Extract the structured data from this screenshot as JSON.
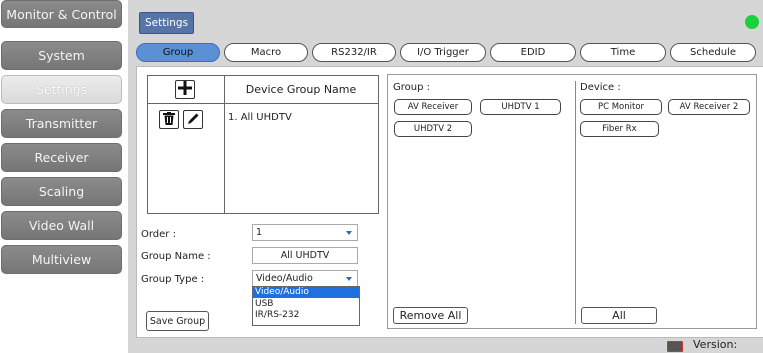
{
  "sidebar": {
    "items": [
      {
        "label": "Monitor & Control"
      },
      {
        "label": "System"
      },
      {
        "label": "Settings"
      },
      {
        "label": "Transmitter"
      },
      {
        "label": "Receiver"
      },
      {
        "label": "Scaling"
      },
      {
        "label": "Video Wall"
      },
      {
        "label": "Multiview"
      }
    ],
    "active": "Settings"
  },
  "header": {
    "title": "Settings",
    "status_color": "#19d13a"
  },
  "tabs": [
    {
      "label": "Group"
    },
    {
      "label": "Macro"
    },
    {
      "label": "RS232/IR"
    },
    {
      "label": "I/O Trigger"
    },
    {
      "label": "EDID"
    },
    {
      "label": "Time"
    },
    {
      "label": "Schedule"
    }
  ],
  "active_tab": "Group",
  "group_table": {
    "column_header": "Device Group Name",
    "rows": [
      "1. All UHDTV"
    ],
    "add_icon": "plus-icon",
    "delete_icon": "trash-icon",
    "edit_icon": "pencil-icon"
  },
  "form": {
    "order_label": "Order :",
    "order_value": "1",
    "group_name_label": "Group Name :",
    "group_name_value": "All UHDTV",
    "group_type_label": "Group Type :",
    "group_type_value": "Video/Audio",
    "group_type_options": [
      "Video/Audio",
      "USB",
      "IR/RS-232"
    ],
    "save_button": "Save Group"
  },
  "group_panel": {
    "label": "Group :",
    "chips": [
      "AV Receiver",
      "UHDTV 1",
      "UHDTV 2"
    ],
    "remove_all_button": "Remove All"
  },
  "device_panel": {
    "label": "Device :",
    "chips": [
      "PC Monitor",
      "AV Receiver 2",
      "Fiber Rx"
    ],
    "all_button": "All"
  },
  "footer": {
    "version_label": "Version:",
    "keyboard_icon": "keyboard-icon"
  },
  "colors": {
    "accent": "#5b8fd6",
    "selected_option": "#1f6fe0",
    "settings_tag": "#5674a8"
  }
}
